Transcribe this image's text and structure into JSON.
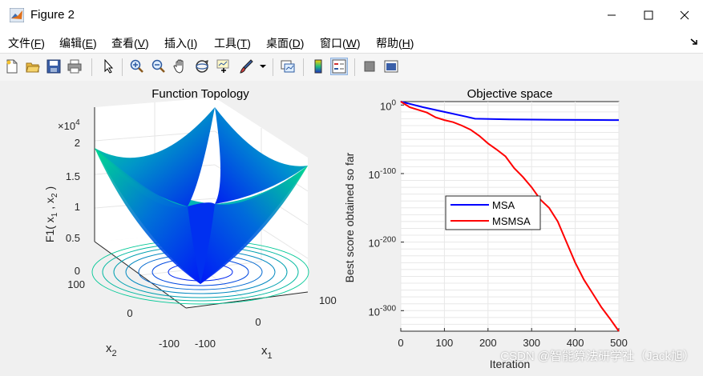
{
  "window": {
    "title": "Figure 2"
  },
  "menu": [
    {
      "label": "文件",
      "key": "F"
    },
    {
      "label": "编辑",
      "key": "E"
    },
    {
      "label": "查看",
      "key": "V"
    },
    {
      "label": "插入",
      "key": "I"
    },
    {
      "label": "工具",
      "key": "T"
    },
    {
      "label": "桌面",
      "key": "D"
    },
    {
      "label": "窗口",
      "key": "W"
    },
    {
      "label": "帮助",
      "key": "H"
    }
  ],
  "toolbar": {
    "icons": [
      "new-figure-icon",
      "open-file-icon",
      "save-icon",
      "print-icon",
      "pointer-icon",
      "zoom-in-icon",
      "zoom-out-icon",
      "pan-hand-icon",
      "rotate-3d-icon",
      "data-cursor-icon",
      "brush-icon",
      "link-plot-icon",
      "colorbar-icon",
      "legend-icon",
      "hide-plot-tools-icon",
      "show-plot-tools-icon"
    ],
    "active": "legend-icon"
  },
  "surface_plot": {
    "title": "Function Topology",
    "exponent_label": "×10",
    "exponent_power": "4",
    "z_ticks": [
      "0",
      "0.5",
      "1",
      "1.5",
      "2"
    ],
    "zlabel_main": "F1( x",
    "zlabel_sub1": "1",
    "zlabel_mid": " , x",
    "zlabel_sub2": "2",
    "zlabel_end": " )",
    "x1_ticks": [
      "-100",
      "0",
      "100"
    ],
    "x2_ticks": [
      "-100",
      "0",
      "100"
    ],
    "x1_label": "x",
    "x1_label_sub": "1",
    "x2_label": "x",
    "x2_label_sub": "2"
  },
  "chart_data": [
    {
      "type": "surface",
      "title": "Function Topology",
      "function": "x1^2 + x2^2",
      "x1_range": [
        -100,
        100
      ],
      "x2_range": [
        -100,
        100
      ],
      "z_range": [
        0,
        20000
      ],
      "z_ticks": [
        0,
        5000,
        10000,
        15000,
        20000
      ],
      "colormap": [
        "#00ff80",
        "#0000ff"
      ]
    },
    {
      "type": "line",
      "title": "Objective space",
      "xlabel": "Iteration",
      "ylabel": "Best score obtained so far",
      "yscale": "log",
      "xlim": [
        0,
        500
      ],
      "ylim_exponent": [
        -330,
        5
      ],
      "x_ticks": [
        0,
        100,
        200,
        300,
        400,
        500
      ],
      "y_tick_exponents": [
        0,
        -100,
        -200,
        -300
      ],
      "legend_position": "middle-left",
      "series": [
        {
          "name": "MSA",
          "color": "#0000ff",
          "x": [
            0,
            50,
            100,
            150,
            170,
            250,
            350,
            450,
            500
          ],
          "log10_y": [
            5,
            -3,
            -10,
            -17,
            -20,
            -21,
            -21.5,
            -21.8,
            -22
          ]
        },
        {
          "name": "MSMSA",
          "color": "#ff0000",
          "x": [
            0,
            20,
            40,
            60,
            80,
            100,
            120,
            140,
            160,
            180,
            200,
            220,
            240,
            260,
            280,
            300,
            320,
            340,
            360,
            380,
            400,
            420,
            440,
            460,
            480,
            500
          ],
          "log10_y": [
            5,
            -3,
            -7,
            -11,
            -18,
            -22,
            -25,
            -30,
            -36,
            -45,
            -56,
            -65,
            -75,
            -92,
            -105,
            -120,
            -138,
            -150,
            -170,
            -200,
            -230,
            -255,
            -275,
            -295,
            -312,
            -330
          ]
        }
      ]
    }
  ],
  "line_plot": {
    "title": "Objective space",
    "xlabel": "Iteration",
    "ylabel": "Best score obtained so far",
    "x_ticks": [
      "0",
      "100",
      "200",
      "300",
      "400",
      "500"
    ],
    "y_tick_base": "10",
    "y_tick_powers": [
      "0",
      "-100",
      "-200",
      "-300"
    ],
    "legend": [
      "MSA",
      "MSMSA"
    ]
  },
  "watermark": "CSDN @智能算法研学社（Jack旭）"
}
